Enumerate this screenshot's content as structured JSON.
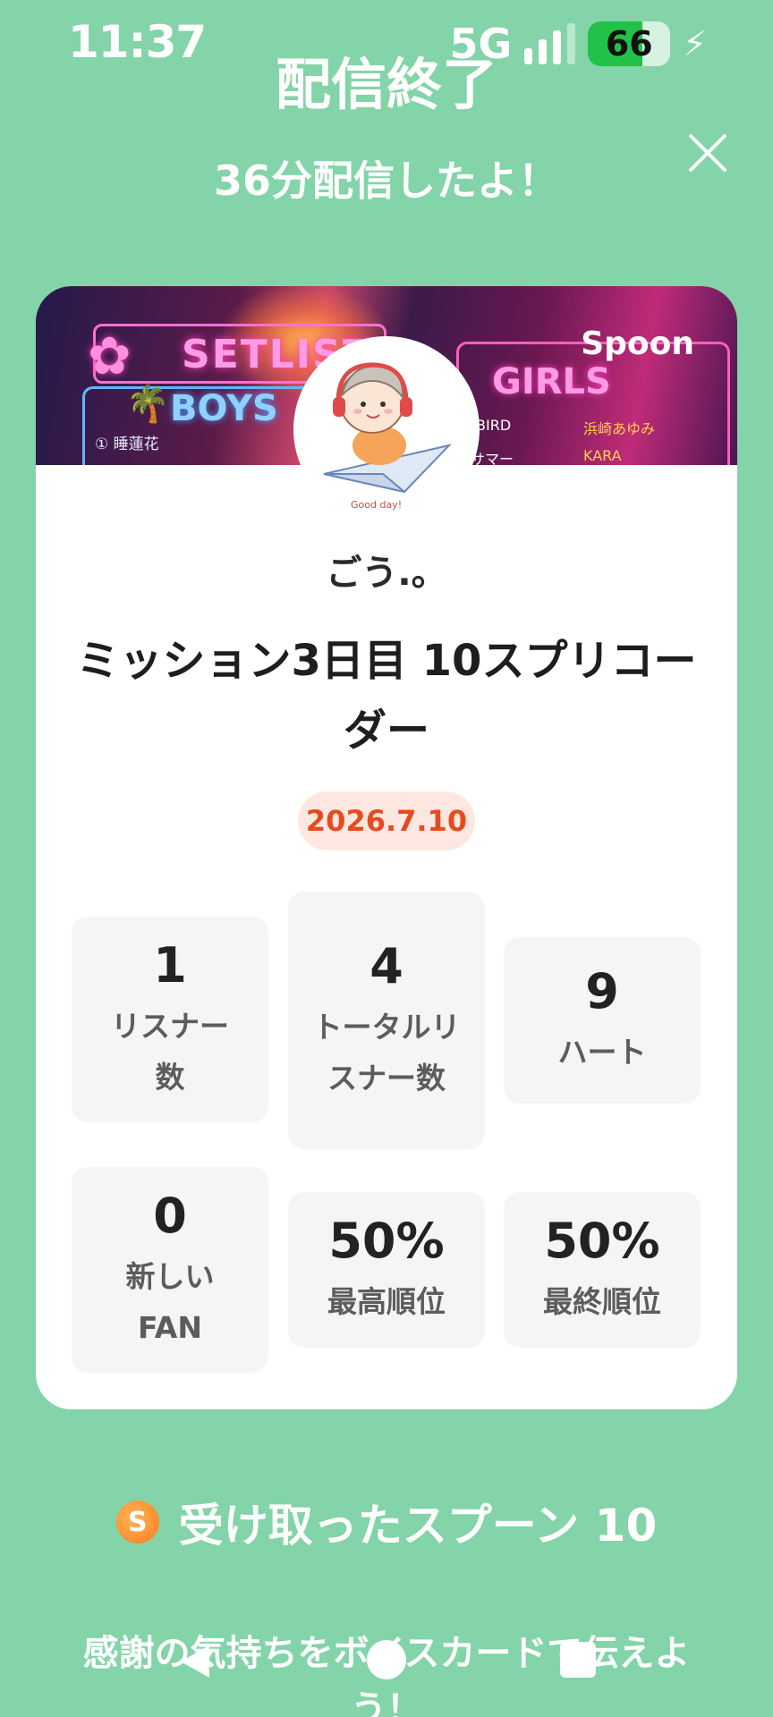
{
  "status_bar": {
    "time": "11:37",
    "network": "5G",
    "battery": "66",
    "battery_level_percent": 66
  },
  "header": {
    "title": "配信終了",
    "subtitle": "36分配信したよ！",
    "close_icon": "close-icon"
  },
  "card": {
    "banner": {
      "setlist": "SETLIST",
      "boys": "BOYS",
      "girls": "GIRLS",
      "brand": "Spoon",
      "boys_row1": "① 睡蓮花",
      "girls_row1_left": "BIRD",
      "girls_row1_right": "浜崎あゆみ",
      "girls_row2_left": "サマー",
      "girls_row2_right": "KARA"
    },
    "avatar_caption": "Good day!",
    "user_name": "ごう.。",
    "live_title": "ミッション3日目 10スプリコーダー",
    "date": "2026.7.10",
    "stats": [
      {
        "value": "1",
        "label": "リスナー数"
      },
      {
        "value": "4",
        "label": "トータルリスナー数"
      },
      {
        "value": "9",
        "label": "ハート"
      },
      {
        "value": "0",
        "label": "新しいFAN"
      },
      {
        "value": "50%",
        "label": "最高順位"
      },
      {
        "value": "50%",
        "label": "最終順位"
      }
    ]
  },
  "spoons": {
    "coin_letter": "S",
    "text": "受け取ったスプーン 10"
  },
  "thanks_text": "感謝の気持ちをボイスカードで伝えよう！",
  "colors": {
    "background": "#83d4a8",
    "date_accent": "#e84a1f",
    "card": "#ffffff"
  }
}
